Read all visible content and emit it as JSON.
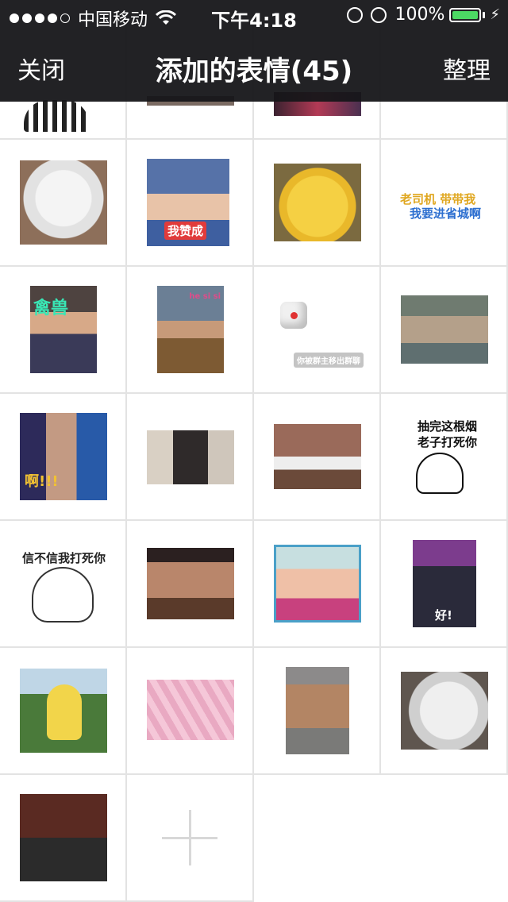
{
  "status_bar": {
    "carrier": "中国移动",
    "time": "下午4:18",
    "battery": "100%",
    "battery_color": "#4cd964",
    "signal_icon": "signal-dots-icon",
    "wifi_icon": "wifi-icon",
    "lock_icon": "orientation-lock-icon",
    "alarm_icon": "alarm-icon",
    "charging_icon": "charging-bolt-icon"
  },
  "nav": {
    "close_label": "关闭",
    "title": "添加的表情(45)",
    "organize_label": "整理",
    "bar_color": "#161619"
  },
  "stickers": {
    "s2": "老司机 带带我",
    "s2b": "我要进省城啊",
    "baby": "我赞成",
    "chat": "你被群主移出群聊",
    "guy2": "he si si",
    "shake": "抽完这根烟",
    "shake2": "老子打死你",
    "cat": "信不信我打死你",
    "jump": "好!",
    "chinese1": "禽兽",
    "chinese2": "啊!!!"
  },
  "add_button": {
    "icon": "plus-icon"
  }
}
